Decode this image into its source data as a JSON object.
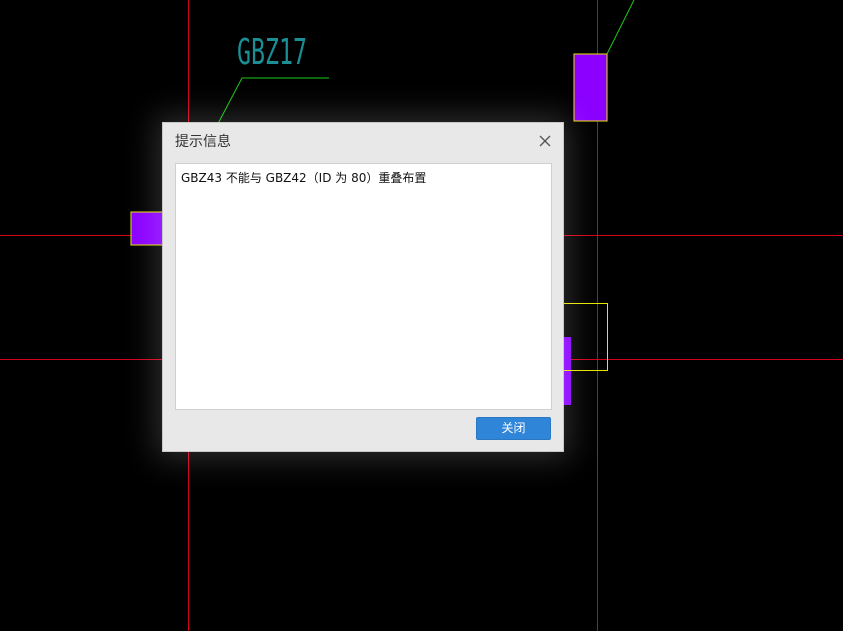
{
  "canvas": {
    "label_text": "GBZ17",
    "colors": {
      "background": "#000000",
      "axis_line": "#d6001c",
      "column_fill": "#8b00ff",
      "label_text": "#1a8f96",
      "leader_line": "#19cc19",
      "selection_outline": "#e6e600"
    }
  },
  "dialog": {
    "title": "提示信息",
    "close_icon": "close-icon",
    "message": "GBZ43 不能与 GBZ42（ID 为 80）重叠布置",
    "close_button_label": "关闭",
    "colors": {
      "button": "#2f86d9",
      "panel": "#e8e8e8"
    }
  }
}
